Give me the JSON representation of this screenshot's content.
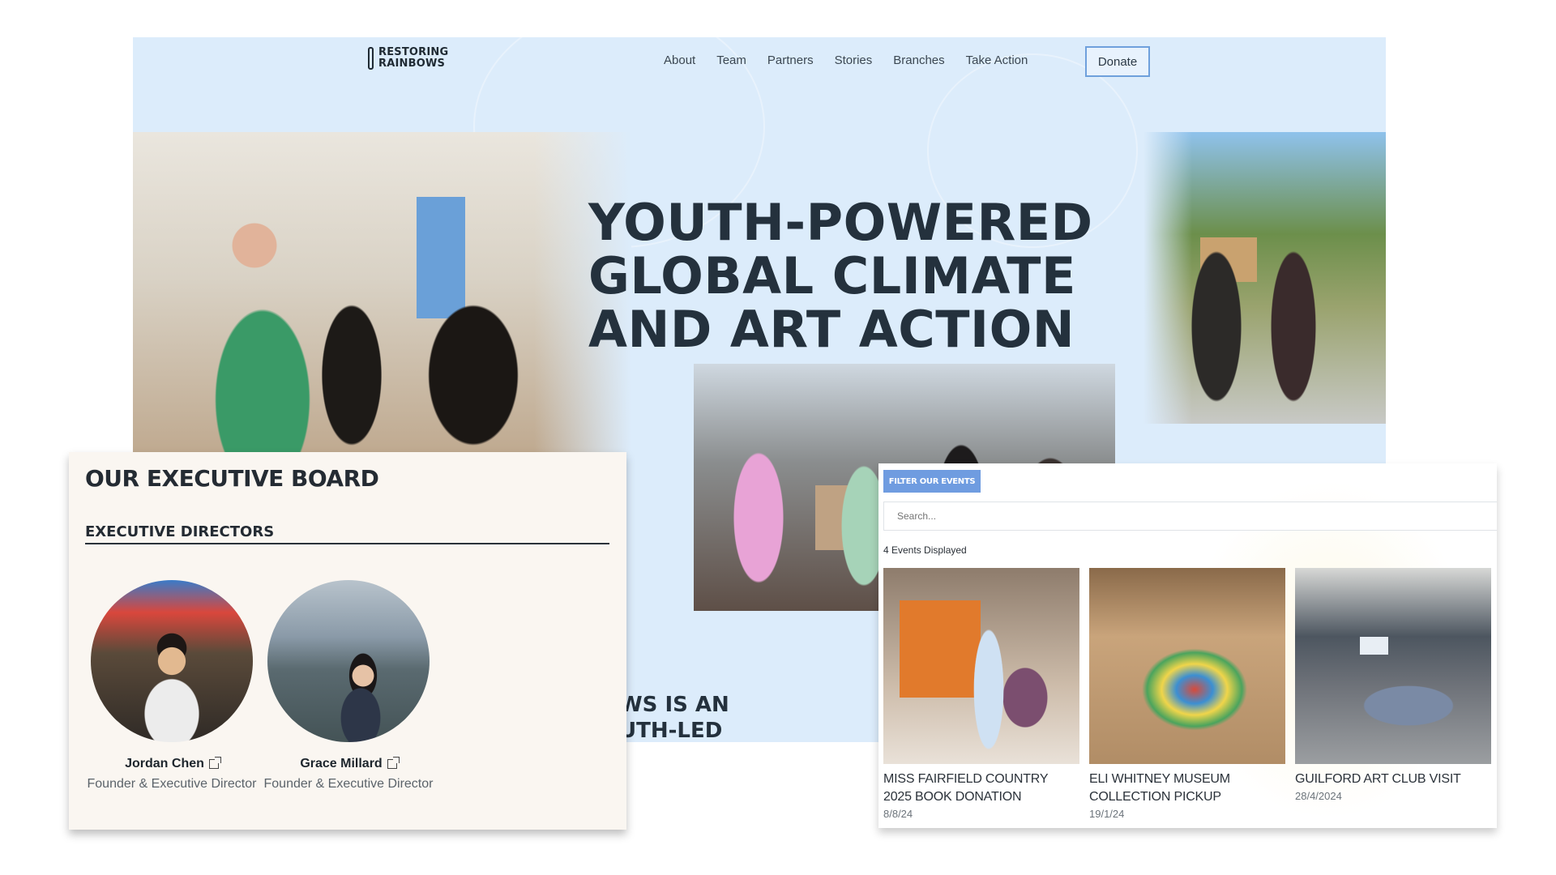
{
  "site": {
    "logo": {
      "line1": "RESTORING",
      "line2": "RAINBOWS"
    },
    "nav": [
      "About",
      "Team",
      "Partners",
      "Stories",
      "Branches",
      "Take Action"
    ],
    "donate_label": "Donate",
    "hero_lines": [
      "YOUTH-POWERED",
      "GLOBAL CLIMATE",
      "AND ART ACTION"
    ],
    "about_teaser": [
      "WS IS AN",
      "UTH-LED"
    ]
  },
  "board": {
    "title": "OUR EXECUTIVE BOARD",
    "subtitle": "EXECUTIVE DIRECTORS",
    "people": [
      {
        "name": "Jordan Chen",
        "role": "Founder & Executive Director"
      },
      {
        "name": "Grace Millard",
        "role": "Founder & Executive Director"
      }
    ]
  },
  "events": {
    "filter_label": "FILTER OUR EVENTS",
    "search_placeholder": "Search...",
    "count_text": "4 Events Displayed",
    "items": [
      {
        "title": "MISS FAIRFIELD COUNTRY 2025 BOOK DONATION",
        "date": "8/8/24"
      },
      {
        "title": "ELI WHITNEY MUSEUM COLLECTION PICKUP",
        "date": "19/1/24"
      },
      {
        "title": "GUILFORD ART CLUB VISIT",
        "date": "28/4/2024"
      }
    ]
  },
  "colors": {
    "hero_bg": "#dcecfb",
    "heading": "#24313d",
    "donate_border": "#6fa0dc",
    "filter_button": "#6f9ce0",
    "card_bg": "#faf6f1"
  }
}
